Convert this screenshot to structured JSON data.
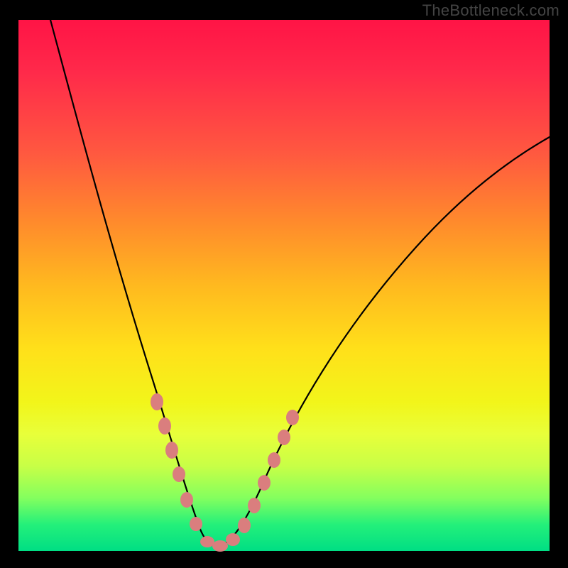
{
  "watermark": "TheBottleneck.com",
  "chart_data": {
    "type": "line",
    "title": "",
    "xlabel": "",
    "ylabel": "",
    "xlim": [
      0,
      100
    ],
    "ylim": [
      0,
      100
    ],
    "series": [
      {
        "name": "bottleneck-curve",
        "x": [
          6,
          10,
          14,
          18,
          22,
          25,
          28,
          30,
          32,
          33.5,
          35,
          37,
          40,
          45,
          52,
          60,
          70,
          82,
          92,
          100
        ],
        "values": [
          100,
          84,
          68,
          53,
          38,
          26,
          16,
          10,
          5,
          2,
          1,
          2,
          6,
          14,
          26,
          38,
          51,
          63,
          72,
          78
        ]
      }
    ],
    "markers": {
      "name": "highlight-beads",
      "color": "#da7e7e",
      "points": [
        {
          "x": 25,
          "y": 26
        },
        {
          "x": 26.5,
          "y": 21
        },
        {
          "x": 28,
          "y": 16
        },
        {
          "x": 29.5,
          "y": 11
        },
        {
          "x": 31,
          "y": 6
        },
        {
          "x": 33,
          "y": 2
        },
        {
          "x": 35,
          "y": 1
        },
        {
          "x": 37,
          "y": 2
        },
        {
          "x": 39,
          "y": 5
        },
        {
          "x": 41,
          "y": 8.5
        },
        {
          "x": 43,
          "y": 12
        },
        {
          "x": 45,
          "y": 15.5
        },
        {
          "x": 47,
          "y": 19
        },
        {
          "x": 49,
          "y": 23
        },
        {
          "x": 50.5,
          "y": 25.5
        }
      ]
    }
  }
}
